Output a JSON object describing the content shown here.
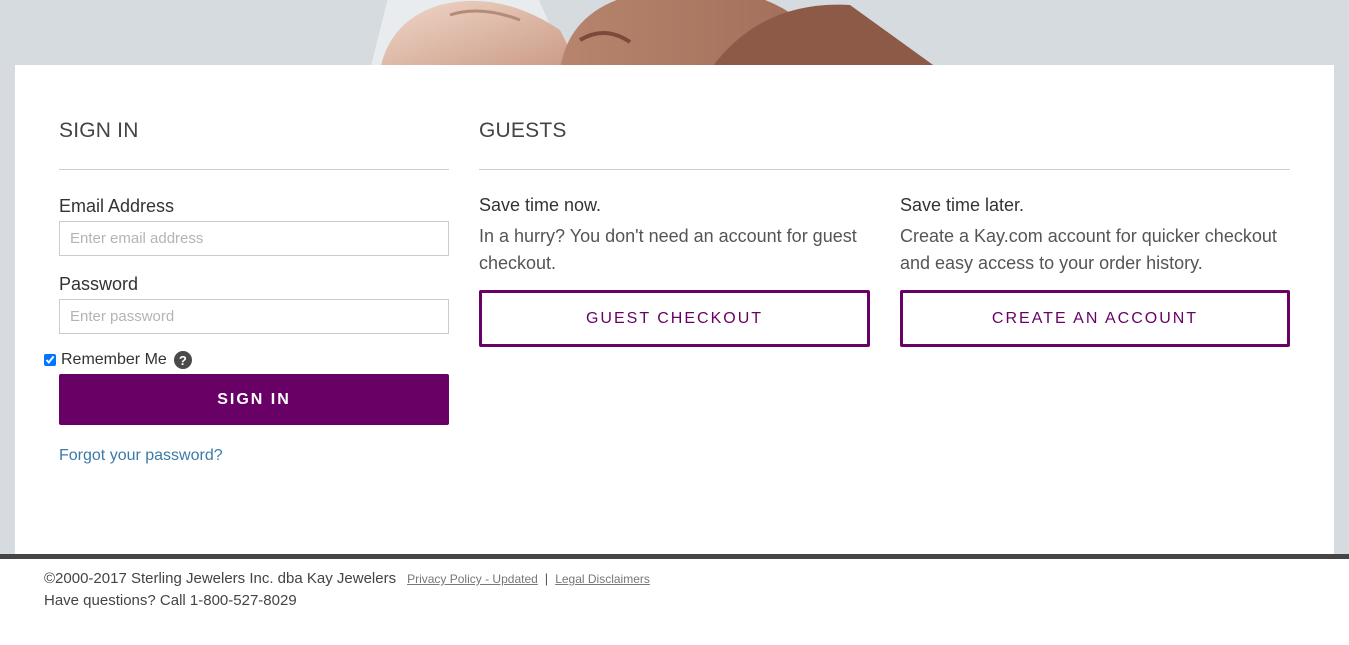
{
  "signin": {
    "title": "SIGN IN",
    "email_label": "Email Address",
    "email_placeholder": "Enter email address",
    "password_label": "Password",
    "password_placeholder": "Enter password",
    "remember_label": "Remember Me",
    "remember_checked": true,
    "help_icon": "?",
    "button_label": "SIGN IN",
    "forgot_link": "Forgot your password?"
  },
  "guests": {
    "title": "GUESTS",
    "now": {
      "title": "Save time now.",
      "text": "In a hurry? You don't need an account for guest checkout.",
      "button_label": "GUEST CHECKOUT"
    },
    "later": {
      "title": "Save time later.",
      "text": "Create a Kay.com account for quicker checkout and easy access to your order history.",
      "button_label": "CREATE AN ACCOUNT"
    }
  },
  "footer": {
    "copyright": "©2000-2017 Sterling Jewelers Inc. dba Kay Jewelers",
    "privacy_link": "Privacy Policy - Updated",
    "separator": "|",
    "legal_link": "Legal Disclaimers",
    "questions": "Have questions? Call 1-800-527-8029"
  },
  "colors": {
    "brand_purple": "#690065",
    "link_blue": "#3c7aa8",
    "page_bg": "#d5dbdf"
  }
}
